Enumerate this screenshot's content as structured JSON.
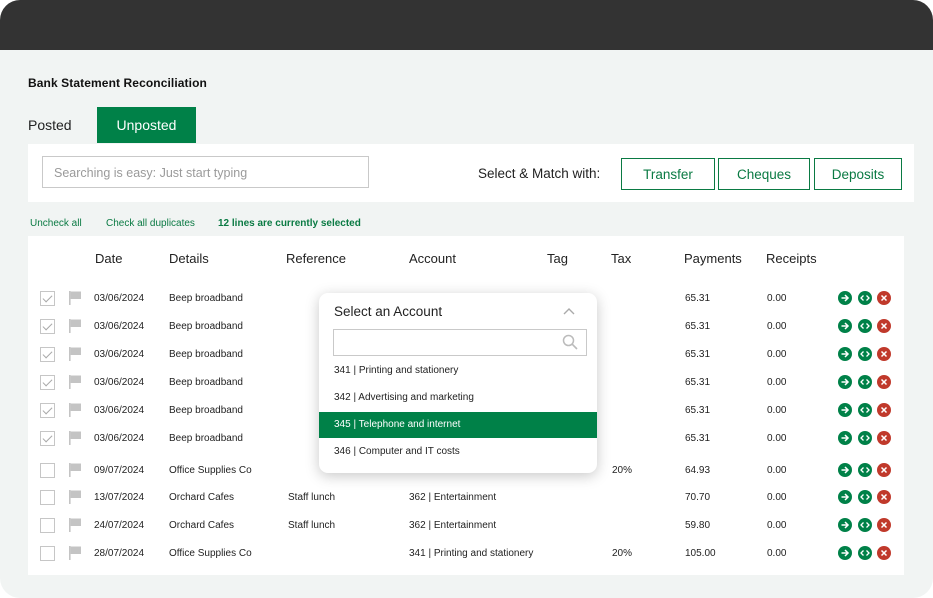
{
  "page": {
    "title": "Bank Statement Reconciliation"
  },
  "tabs": {
    "posted": "Posted",
    "unposted": "Unposted"
  },
  "toolbar": {
    "search_placeholder": "Searching is easy: Just start typing",
    "match_label": "Select & Match with:",
    "transfer": "Transfer",
    "cheques": "Cheques",
    "deposits": "Deposits"
  },
  "links": {
    "uncheck_all": "Uncheck all",
    "check_duplicates": "Check all duplicates",
    "selected_count": "12 lines are currently selected"
  },
  "columns": [
    "Date",
    "Details",
    "Reference",
    "Account",
    "Tag",
    "Tax",
    "Payments",
    "Receipts"
  ],
  "rows": [
    {
      "checked": true,
      "date": "03/06/2024",
      "details": "Beep broadband",
      "reference": "",
      "account": "",
      "tax": "",
      "payments": "65.31",
      "receipts": "0.00"
    },
    {
      "checked": true,
      "date": "03/06/2024",
      "details": "Beep broadband",
      "reference": "",
      "account": "",
      "tax": "",
      "payments": "65.31",
      "receipts": "0.00"
    },
    {
      "checked": true,
      "date": "03/06/2024",
      "details": "Beep broadband",
      "reference": "",
      "account": "",
      "tax": "",
      "payments": "65.31",
      "receipts": "0.00"
    },
    {
      "checked": true,
      "date": "03/06/2024",
      "details": "Beep broadband",
      "reference": "",
      "account": "",
      "tax": "",
      "payments": "65.31",
      "receipts": "0.00"
    },
    {
      "checked": true,
      "date": "03/06/2024",
      "details": "Beep broadband",
      "reference": "",
      "account": "",
      "tax": "",
      "payments": "65.31",
      "receipts": "0.00"
    },
    {
      "checked": true,
      "date": "03/06/2024",
      "details": "Beep broadband",
      "reference": "",
      "account": "",
      "tax": "",
      "payments": "65.31",
      "receipts": "0.00"
    },
    {
      "checked": false,
      "date": "09/07/2024",
      "details": "Office Supplies Co",
      "reference": "",
      "account": "",
      "tax": "20%",
      "payments": "64.93",
      "receipts": "0.00"
    },
    {
      "checked": false,
      "date": "13/07/2024",
      "details": "Orchard Cafes",
      "reference": "Staff lunch",
      "account": "362 | Entertainment",
      "tax": "",
      "payments": "70.70",
      "receipts": "0.00"
    },
    {
      "checked": false,
      "date": "24/07/2024",
      "details": "Orchard Cafes",
      "reference": "Staff lunch",
      "account": "362 | Entertainment",
      "tax": "",
      "payments": "59.80",
      "receipts": "0.00"
    },
    {
      "checked": false,
      "date": "28/07/2024",
      "details": "Office Supplies Co",
      "reference": "",
      "account": "341 | Printing and stationery",
      "tax": "20%",
      "payments": "105.00",
      "receipts": "0.00"
    }
  ],
  "dropdown": {
    "title": "Select an Account",
    "search_value": "",
    "options": [
      {
        "label": "341 | Printing and stationery",
        "selected": false
      },
      {
        "label": "342 | Advertising and marketing",
        "selected": false
      },
      {
        "label": "345 | Telephone and internet",
        "selected": true
      },
      {
        "label": "346 | Computer and IT costs",
        "selected": false
      }
    ]
  },
  "icons": {
    "flag": "flag-icon",
    "post": "arrow-right-icon",
    "split": "code-split-icon",
    "delete": "close-icon",
    "search": "search-icon",
    "chevron": "chevron-up-icon"
  },
  "colors": {
    "brand_green": "#008148",
    "delete_red": "#c0392b",
    "topbar": "#333333"
  }
}
